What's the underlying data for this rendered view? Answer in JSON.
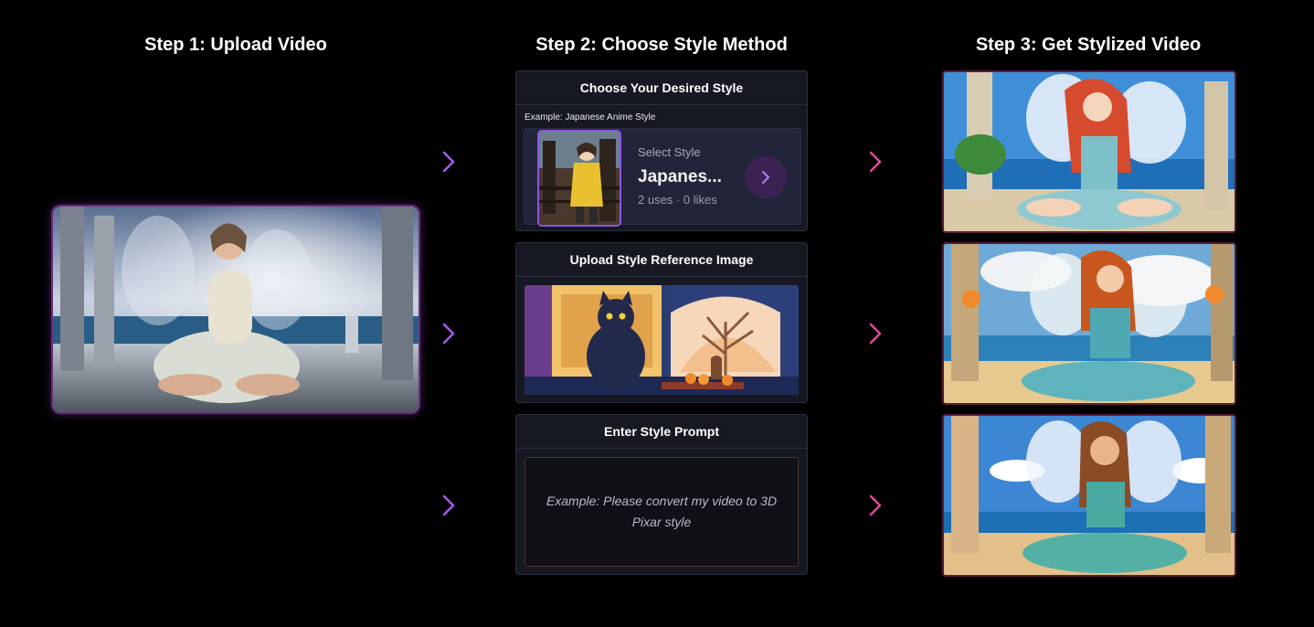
{
  "steps": {
    "step1_title": "Step 1: Upload Video",
    "step2_title": "Step 2: Choose Style Method",
    "step3_title": "Step 3: Get Stylized Video"
  },
  "methods": {
    "desired_style": {
      "title": "Choose Your Desired Style",
      "example_caption": "Example: Japanese Anime Style",
      "select_label": "Select Style",
      "style_name": "Japanes...",
      "style_meta": "2 uses · 0 likes"
    },
    "reference_image": {
      "title": "Upload Style Reference Image"
    },
    "style_prompt": {
      "title": "Enter Style Prompt",
      "placeholder": "Example: Please convert my video to 3D Pixar style"
    }
  },
  "colors": {
    "step1_arrow": "#a35bf0",
    "step3_arrow": "#e0489a",
    "background": "#000000",
    "card_bg": "#161922"
  },
  "icons": {
    "arrow": "chevron-right-icon",
    "picker_button": "chevron-right-icon"
  }
}
